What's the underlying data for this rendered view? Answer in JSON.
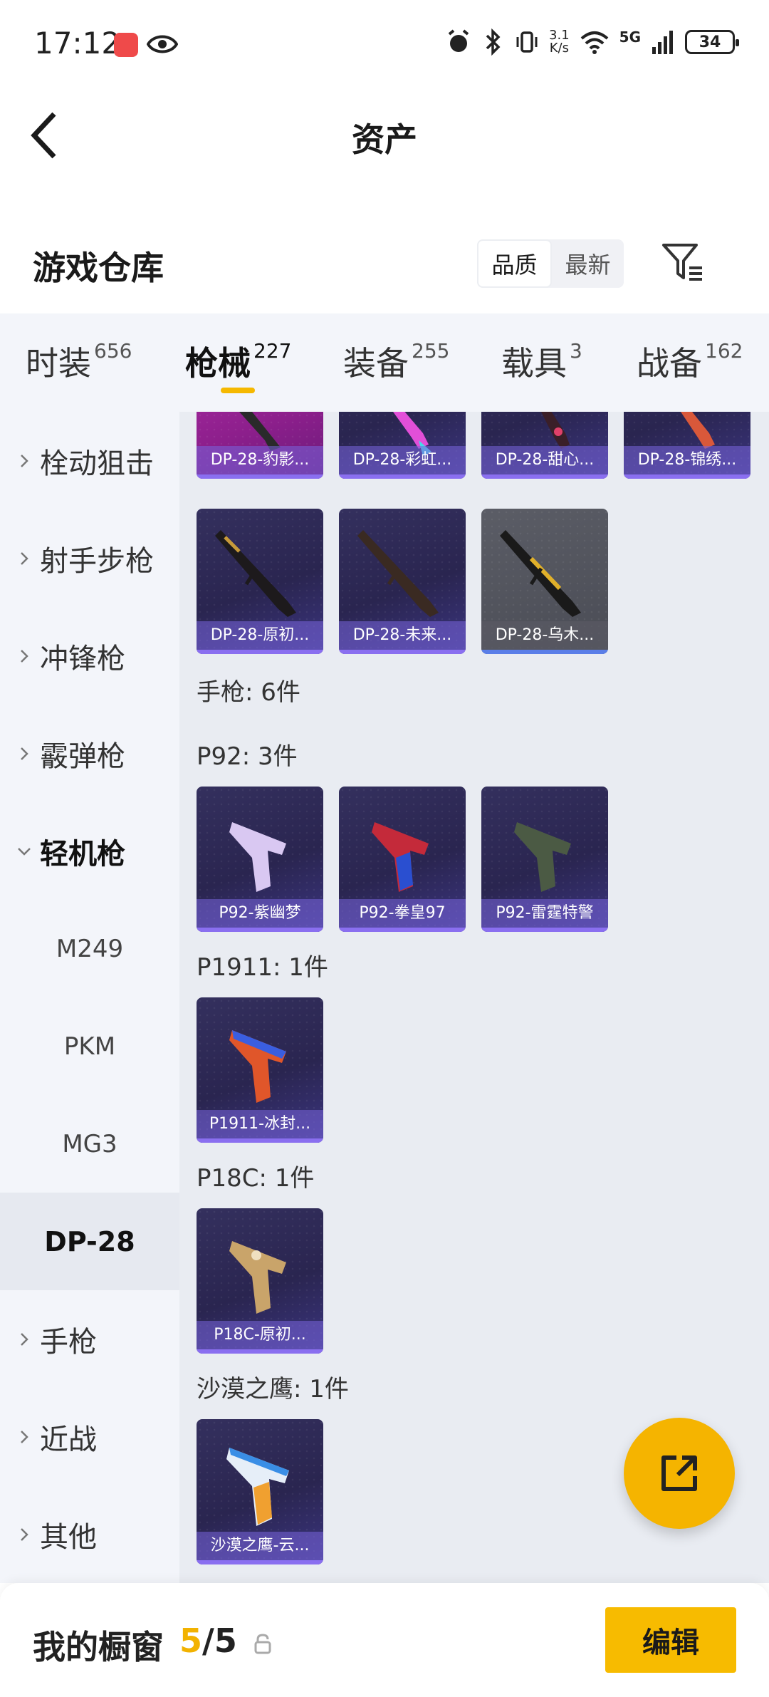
{
  "status_bar": {
    "time": "17:12",
    "net_speed_value": "3.1",
    "net_speed_unit": "K/s",
    "network": "5G",
    "battery": "34"
  },
  "nav": {
    "title": "资产"
  },
  "warehouse": {
    "title": "游戏仓库",
    "sort": {
      "quality": "品质",
      "latest": "最新",
      "selected": "品质"
    }
  },
  "tabs": [
    {
      "label": "时装",
      "count": "656"
    },
    {
      "label": "枪械",
      "count": "227",
      "active": true
    },
    {
      "label": "装备",
      "count": "255"
    },
    {
      "label": "载具",
      "count": "3"
    },
    {
      "label": "战备",
      "count": "162"
    }
  ],
  "sidebar": {
    "items": [
      {
        "label": "栓动狙击"
      },
      {
        "label": "射手步枪"
      },
      {
        "label": "冲锋枪"
      },
      {
        "label": "霰弹枪"
      },
      {
        "label": "轻机枪",
        "expanded": true
      },
      {
        "label": "手枪"
      },
      {
        "label": "近战"
      },
      {
        "label": "其他"
      }
    ],
    "sub_items": [
      "M249",
      "PKM",
      "MG3",
      "DP-28"
    ],
    "selected_sub": "DP-28"
  },
  "content": {
    "top_row": [
      "DP-28-豹影...",
      "DP-28-彩虹...",
      "DP-28-甜心...",
      "DP-28-锦绣..."
    ],
    "second_row": [
      "DP-28-原初...",
      "DP-28-未来...",
      "DP-28-乌木..."
    ],
    "pistol_header": "手枪: 6件",
    "p92_header": "P92: 3件",
    "p92_items": [
      "P92-紫幽梦",
      "P92-拳皇97",
      "P92-雷霆特警"
    ],
    "p1911_header": "P1911: 1件",
    "p1911_items": [
      "P1911-冰封..."
    ],
    "p18c_header": "P18C: 1件",
    "p18c_items": [
      "P18C-原初..."
    ],
    "deagle_header": "沙漠之鹰: 1件",
    "deagle_items": [
      "沙漠之鹰-云..."
    ]
  },
  "bottom_bar": {
    "title": "我的橱窗",
    "current": "5",
    "separator": "/",
    "total": "5",
    "edit_label": "编辑"
  },
  "colors": {
    "accent": "#f5b800",
    "tile_purple": "#2a2550",
    "tile_pink": "#b12ca8",
    "tile_gray": "#4a4c55"
  },
  "icons": {
    "back": "back-arrow-icon",
    "filter": "filter-icon",
    "fab": "share-external-icon",
    "lock": "lock-icon",
    "chevron": "chevron-right-icon"
  }
}
